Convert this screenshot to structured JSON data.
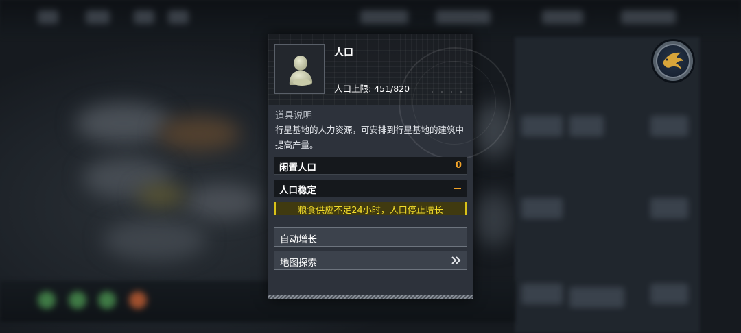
{
  "popup": {
    "title": "人口",
    "capacity_label": "人口上限: 451/820",
    "description_header": "道具说明",
    "description": "行星基地的人力资源，可安排到行星基地的建筑中提高产量。",
    "idle_population": {
      "label": "闲置人口",
      "value": "0"
    },
    "population_stable": {
      "label": "人口稳定"
    },
    "warning": "粮食供应不足24小时，人口停止增长",
    "auto_growth_button": "自动增长",
    "map_explore_button": "地图探索",
    "icon": "population-person-icon"
  },
  "colors": {
    "accent_orange": "#f0a228",
    "warning_yellow": "#f2dc2a",
    "panel_bg": "#2d323b"
  },
  "emblem": {
    "icon": "phoenix-emblem-icon"
  }
}
